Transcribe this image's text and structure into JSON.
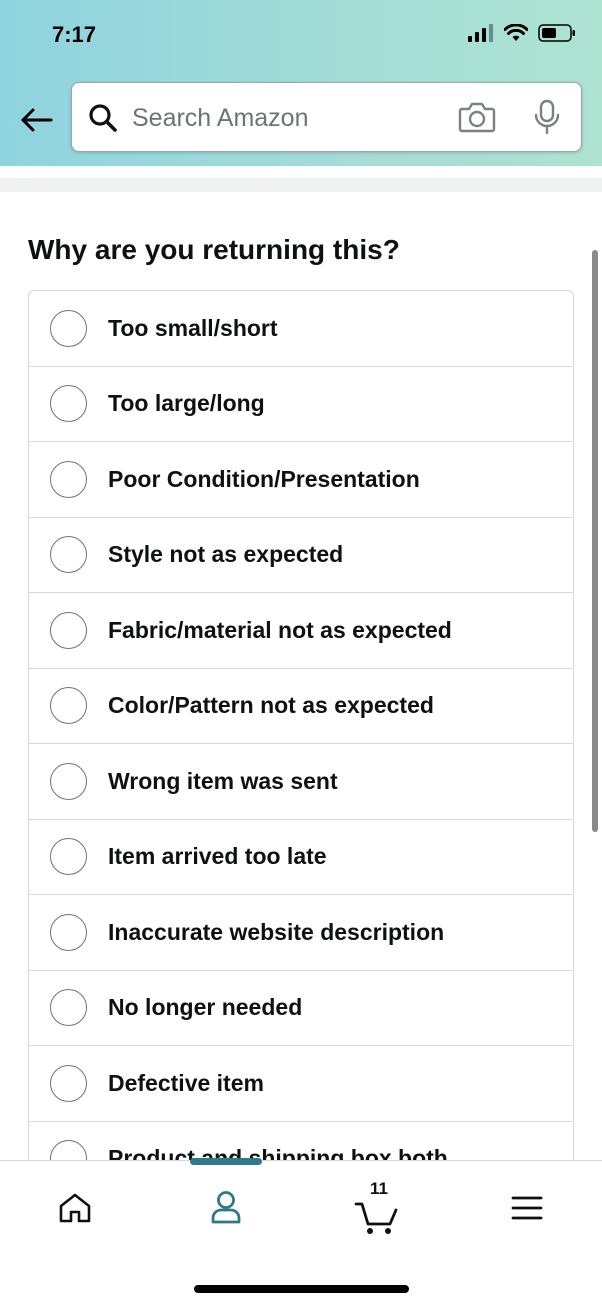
{
  "status_bar": {
    "time": "7:17"
  },
  "search": {
    "placeholder": "Search Amazon"
  },
  "question": "Why are you returning this?",
  "options": [
    "Too small/short",
    "Too large/long",
    "Poor Condition/Presentation",
    "Style not as expected",
    "Fabric/material not as expected",
    "Color/Pattern not as expected",
    "Wrong item was sent",
    "Item arrived too late",
    "Inaccurate website description",
    "No longer needed",
    "Defective item",
    "Product and shipping box both"
  ],
  "bottom_nav": {
    "cart_count": "11"
  },
  "colors": {
    "accent": "#2f7a86",
    "header_gradient_start": "#8fd3df",
    "header_gradient_end": "#aee3d2"
  }
}
